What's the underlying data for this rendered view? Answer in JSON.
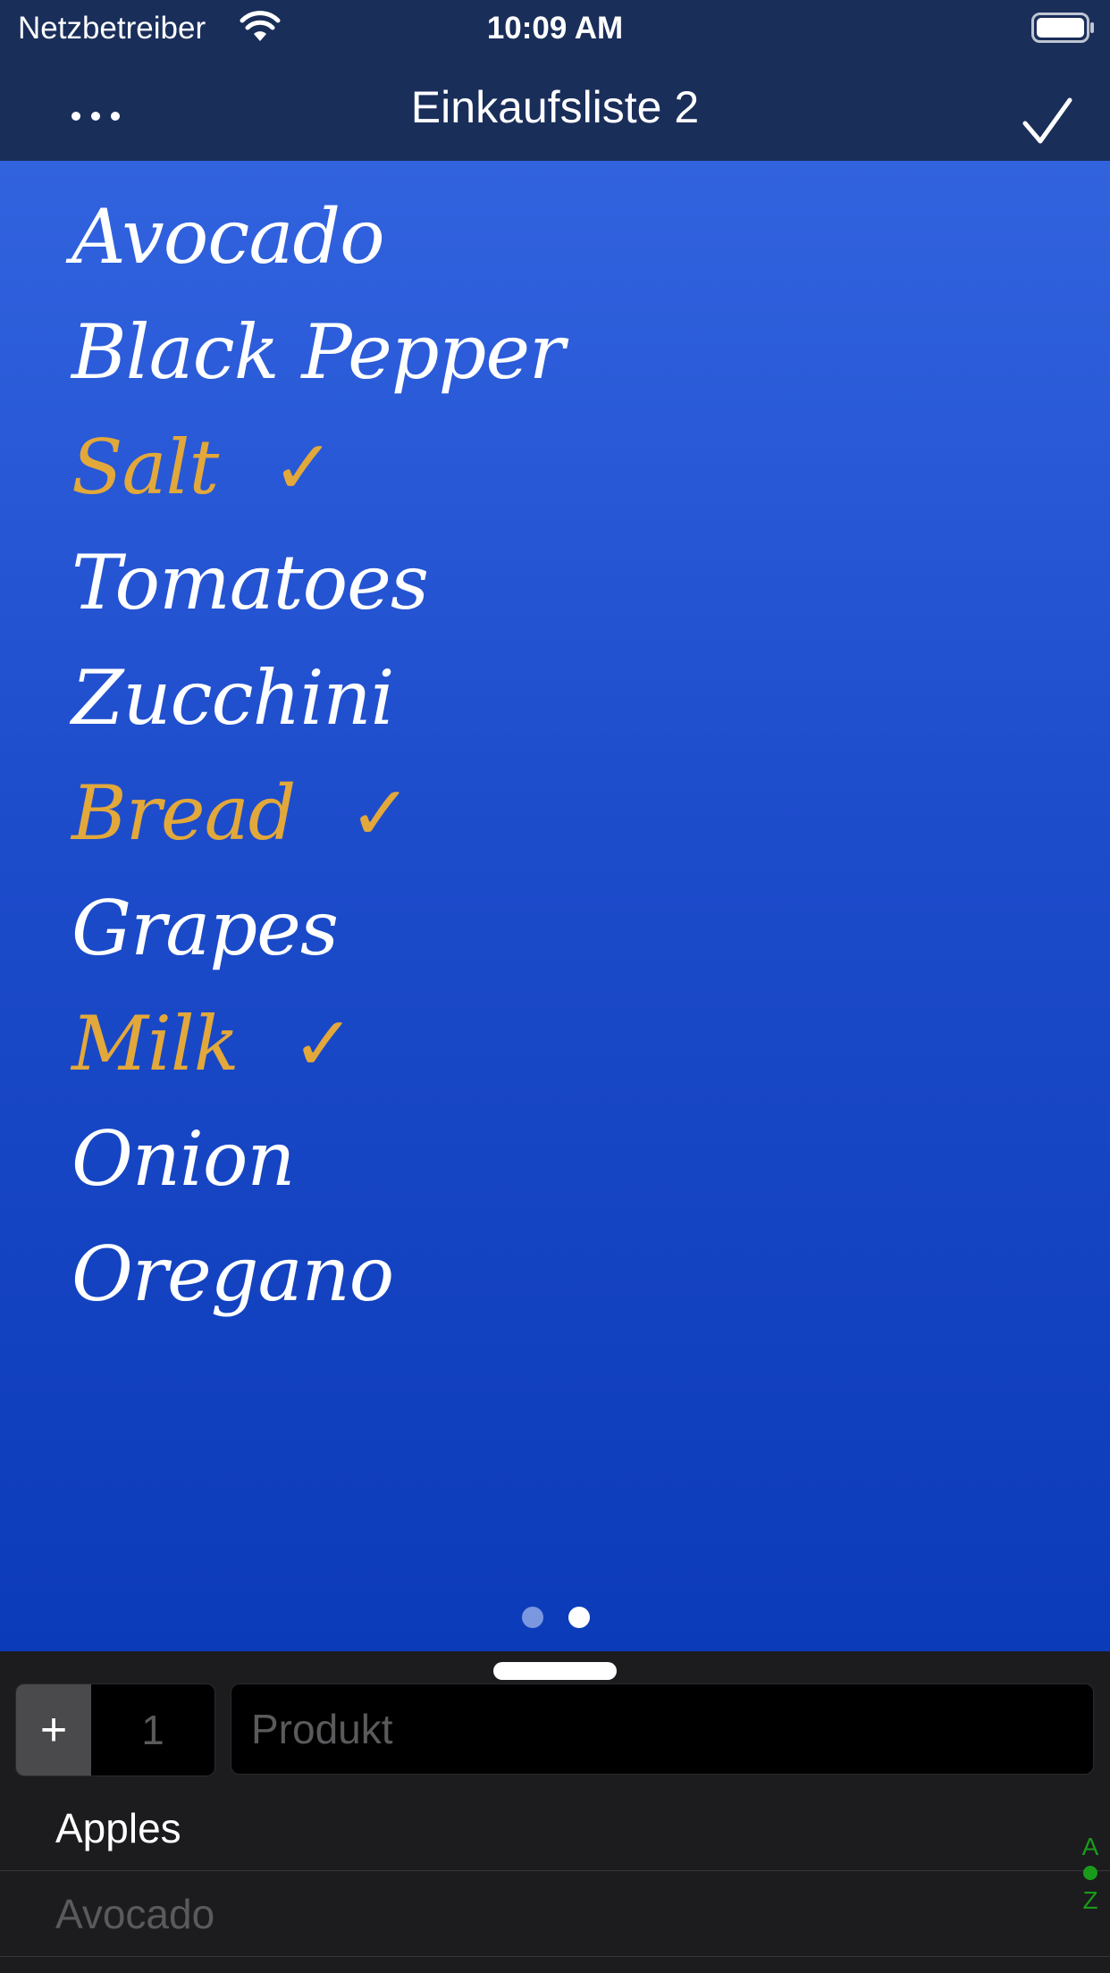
{
  "status_bar": {
    "carrier": "Netzbetreiber",
    "time": "10:09 AM"
  },
  "nav": {
    "title": "Einkaufsliste 2",
    "more_icon": "ellipsis-icon",
    "done_icon": "checkmark-icon"
  },
  "list": {
    "items": [
      {
        "label": "Avocado",
        "checked": false
      },
      {
        "label": "Black Pepper",
        "checked": false
      },
      {
        "label": "Salt",
        "checked": true,
        "mark": "✓"
      },
      {
        "label": "Tomatoes",
        "checked": false
      },
      {
        "label": "Zucchini",
        "checked": false
      },
      {
        "label": "Bread",
        "checked": true,
        "mark": "✓"
      },
      {
        "label": "Grapes",
        "checked": false
      },
      {
        "label": "Milk",
        "checked": true,
        "mark": "✓"
      },
      {
        "label": "Onion",
        "checked": false
      },
      {
        "label": "Oregano",
        "checked": false
      }
    ]
  },
  "page_control": {
    "pages": 2,
    "current": 2
  },
  "entry": {
    "plus_label": "+",
    "quantity": "1",
    "product_placeholder": "Produkt"
  },
  "suggestions": [
    {
      "label": "Apples"
    },
    {
      "label": "Avocado"
    }
  ],
  "index": {
    "top": "A",
    "bottom": "Z"
  },
  "colors": {
    "nav_bg": "#1a2e5a",
    "checked": "#e3a83a",
    "index_green": "#1a9a1a",
    "panel_bg": "#1c1c1e"
  }
}
